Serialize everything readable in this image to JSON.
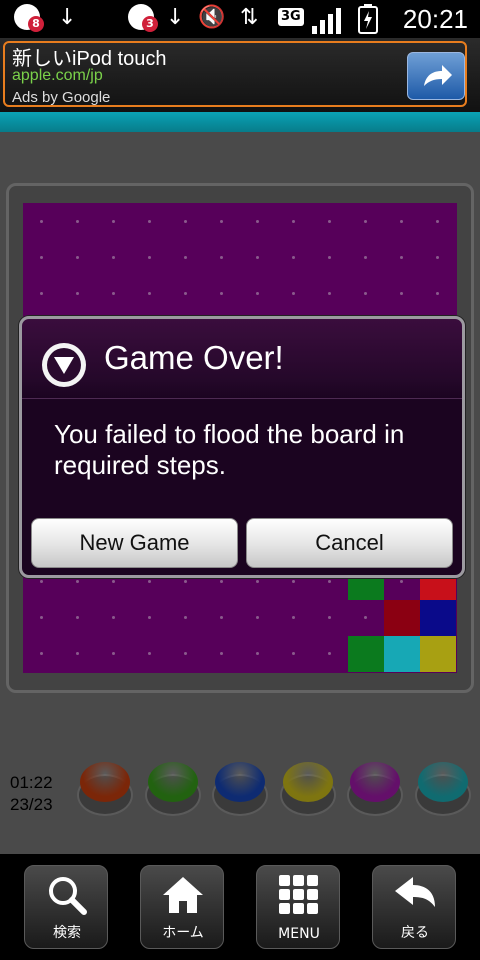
{
  "status_bar": {
    "notif_badge_1": "8",
    "notif_badge_2": "3",
    "network": "3G",
    "time": "20:21"
  },
  "ad": {
    "title": "新しいiPod touch",
    "url": "apple.com/jp",
    "attribution": "Ads by Google",
    "action_icon": "share-arrow-icon"
  },
  "game": {
    "timer": "01:22",
    "steps": "23/23",
    "flood_color": "#57005a",
    "board_cells": [
      {
        "color": "#2a1f18"
      },
      {
        "color": "#c8101a"
      },
      {
        "color": "#0b7a1e"
      },
      {
        "color": "#8b0012"
      },
      {
        "color": "#0a0a8a"
      },
      {
        "color": "#0b7a1e"
      },
      {
        "color": "#17a8b5"
      },
      {
        "color": "#a8a012"
      }
    ],
    "color_buttons": [
      {
        "name": "orange",
        "color": "#e0450f"
      },
      {
        "name": "green",
        "color": "#3db21d"
      },
      {
        "name": "blue",
        "color": "#1a4fd0"
      },
      {
        "name": "yellow",
        "color": "#e5d41e"
      },
      {
        "name": "purple",
        "color": "#b51bc0"
      },
      {
        "name": "cyan",
        "color": "#1ec2cc"
      }
    ]
  },
  "dialog": {
    "title": "Game Over!",
    "message": "You failed to flood the board in required steps.",
    "buttons": {
      "new_game": "New Game",
      "cancel": "Cancel"
    }
  },
  "bottom_nav": [
    {
      "label": "検索",
      "icon": "search-icon"
    },
    {
      "label": "ホーム",
      "icon": "home-icon"
    },
    {
      "label": "MENU",
      "icon": "menu-grid-icon"
    },
    {
      "label": "戻る",
      "icon": "back-arrow-icon"
    }
  ]
}
